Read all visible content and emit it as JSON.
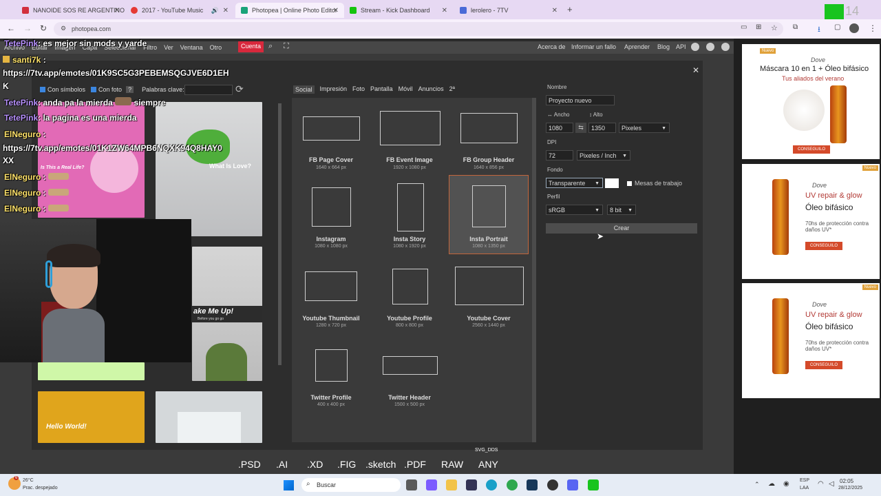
{
  "browser": {
    "tabs": [
      {
        "label": "NANOIDE SOS RE ARGENTINO",
        "color": "#d2303d"
      },
      {
        "label": "2017 - YouTube Music",
        "color": "#e53935"
      },
      {
        "label": "Photopea | Online Photo Editor",
        "color": "#1aa37a"
      },
      {
        "label": "Stream - Kick Dashboard",
        "color": "#15c40e"
      },
      {
        "label": "lerolero - 7TV",
        "color": "#4a6ad7"
      }
    ],
    "url": "photopea.com",
    "new_tab": "+"
  },
  "photopea": {
    "menu": [
      "Archivo",
      "Editar",
      "Imagen",
      "Capa",
      "Seleccionar",
      "Filtro",
      "Ver",
      "Ventana",
      "Otro"
    ],
    "cuenta": "Cuenta",
    "right_links": [
      "Acerca de",
      "Informar un fallo",
      "Aprender",
      "Blog",
      "API"
    ]
  },
  "dialog": {
    "options": {
      "con_simbolos": "Con símbolos",
      "con_foto": "Con foto",
      "help": "?",
      "keywords_label": "Palabras clave:"
    },
    "category_tabs": [
      "Social",
      "Impresión",
      "Foto",
      "Pantalla",
      "Móvil",
      "Anuncios",
      "2ª"
    ],
    "templates": [
      {
        "name": "FB Page Cover",
        "size": "1640 x 664 px"
      },
      {
        "name": "FB Event Image",
        "size": "1920 x 1080 px"
      },
      {
        "name": "FB Group Header",
        "size": "1640 x 856 px"
      },
      {
        "name": "Instagram",
        "size": "1080 x 1080 px"
      },
      {
        "name": "Insta Story",
        "size": "1080 x 1920 px"
      },
      {
        "name": "Insta Portrait",
        "size": "1080 x 1350 px"
      },
      {
        "name": "Youtube Thumbnail",
        "size": "1280 x 720 px"
      },
      {
        "name": "Youtube Profile",
        "size": "800 x 800 px"
      },
      {
        "name": "Youtube Cover",
        "size": "2560 x 1440 px"
      },
      {
        "name": "Twitter Profile",
        "size": "400 x 400 px"
      },
      {
        "name": "Twitter Header",
        "size": "1500 x 500 px"
      }
    ],
    "form": {
      "nombre_label": "Nombre",
      "nombre_value": "Proyecto nuevo",
      "ancho_label": "↔ Ancho",
      "alto_label": "↕ Alto",
      "ancho_value": "1080",
      "alto_value": "1350",
      "unit": "Pixeles",
      "dpi_label": "DPI",
      "dpi_value": "72",
      "dpi_unit": "Pixeles / Inch",
      "fondo_label": "Fondo",
      "fondo_value": "Transparente",
      "mesas": "Mesas de trabajo",
      "perfil_label": "Perfil",
      "perfil_value": "sRGB",
      "bits": "8 bit",
      "crear": "Crear"
    },
    "gallery": {
      "card1_title": "Is This a Real Life?",
      "card2_title": "What Is Love?",
      "card4_title": "ake Me Up!",
      "card4_sub": "Before you go go",
      "card5_title": "Hello World!"
    }
  },
  "chat": [
    {
      "nick": "TetePink",
      "text": ": es mejor sin mods y yarde"
    },
    {
      "nick": "santi7k",
      "text": " :"
    },
    {
      "nick": "",
      "text": "https://7tv.app/emotes/01K9SC5G3PEBEMSQGJVE6D1EH"
    },
    {
      "nick": "",
      "text": "K"
    },
    {
      "nick": "TetePink",
      "text": ": anda pa la mierda"
    },
    {
      "nick": "",
      "text": "siempre"
    },
    {
      "nick": "TetePink",
      "text": ": la pagina es una mierda"
    },
    {
      "nick": "ElNeguro",
      "text": " :"
    },
    {
      "nick": "",
      "text": "https://7tv.app/emotes/01K1ZW64MPB6NQXK94Q8HAY0"
    },
    {
      "nick": "",
      "text": "XX"
    },
    {
      "nick": "ElNeguro",
      "text": " :"
    },
    {
      "nick": "ElNeguro",
      "text": " :"
    },
    {
      "nick": "ElNeguro",
      "text": " :"
    }
  ],
  "formats": [
    ".PSD",
    ".AI",
    ".XD",
    ".FIG",
    ".sketch",
    ".PDF",
    "RAW",
    "ANY"
  ],
  "formats_top": "SVG_DDS",
  "ads": [
    {
      "badge": "Nuevo",
      "brand": "Dove",
      "title": "Máscara 10 en 1 + Óleo bifásico",
      "subtitle": "Tus aliados del verano",
      "cta": "CONSEGUILO"
    },
    {
      "badge": "Nuevo",
      "brand": "Dove",
      "title": "UV repair & glow",
      "subtitle": "Óleo bifásico",
      "line": "70hs de protección contra daños UV*",
      "cta": "CONSEGUILO"
    },
    {
      "badge": "Nuevo",
      "brand": "Dove",
      "title": "UV repair & glow",
      "subtitle": "Óleo bifásico",
      "line": "70hs de protección contra daños UV*",
      "cta": "CONSEGUILO"
    }
  ],
  "taskbar": {
    "weather_temp": "26°C",
    "weather_desc": "Prac. despejado",
    "search": "Buscar",
    "lang": "ESP",
    "lang2": "LAA",
    "time": "02:05",
    "date": "28/12/2025",
    "notif": "6"
  },
  "overlay_corner": "14"
}
